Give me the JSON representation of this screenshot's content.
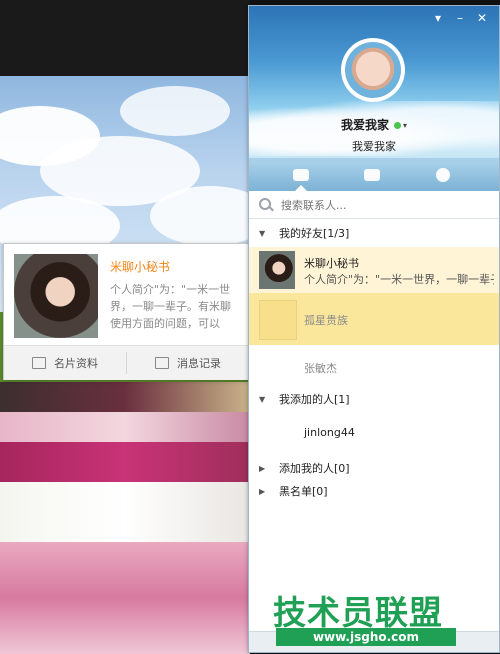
{
  "window": {
    "user_name": "我爱我家",
    "status_caret": "▾",
    "signature": "我爱我家",
    "controls": [
      "shirt-icon",
      "minimize-icon",
      "close-icon"
    ]
  },
  "tabs": [
    {
      "name": "messages",
      "icon": "chat-bubble-icon",
      "active": true
    },
    {
      "name": "groups",
      "icon": "group-icon",
      "active": false
    },
    {
      "name": "recent",
      "icon": "clock-icon",
      "active": false
    }
  ],
  "search": {
    "placeholder": "搜索联系人..."
  },
  "groups": {
    "friends": {
      "label": "我的好友[1/3]",
      "arrow": "▼"
    },
    "added": {
      "label": "我添加的人[1]",
      "arrow": "▼"
    },
    "added_me": {
      "label": "添加我的人[0]",
      "arrow": "▶"
    },
    "blacklist": {
      "label": "黑名单[0]",
      "arrow": "▶"
    }
  },
  "contacts": {
    "secretary": {
      "name": "米聊小秘书",
      "desc": "个人简介\"为：\"一米一世界，一聊一辈子。"
    },
    "c2": {
      "name": "孤星贵族"
    },
    "c3": {
      "name": "张敏杰"
    },
    "c4": {
      "name": "jinlong44"
    }
  },
  "card": {
    "name": "米聊小秘书",
    "desc": "个人简介\"为：\"一米一世界，一聊一辈子。有米聊使用方面的问题，可以",
    "btn_profile": "名片资料",
    "btn_history": "消息记录"
  },
  "watermark": {
    "title": "技术员联盟",
    "url": "www.jsgho.com"
  },
  "colors": {
    "accent_orange": "#f08519",
    "online_green": "#4cc34a",
    "selected_row": "#fbe79c",
    "watermark_green": "#1fa055"
  }
}
